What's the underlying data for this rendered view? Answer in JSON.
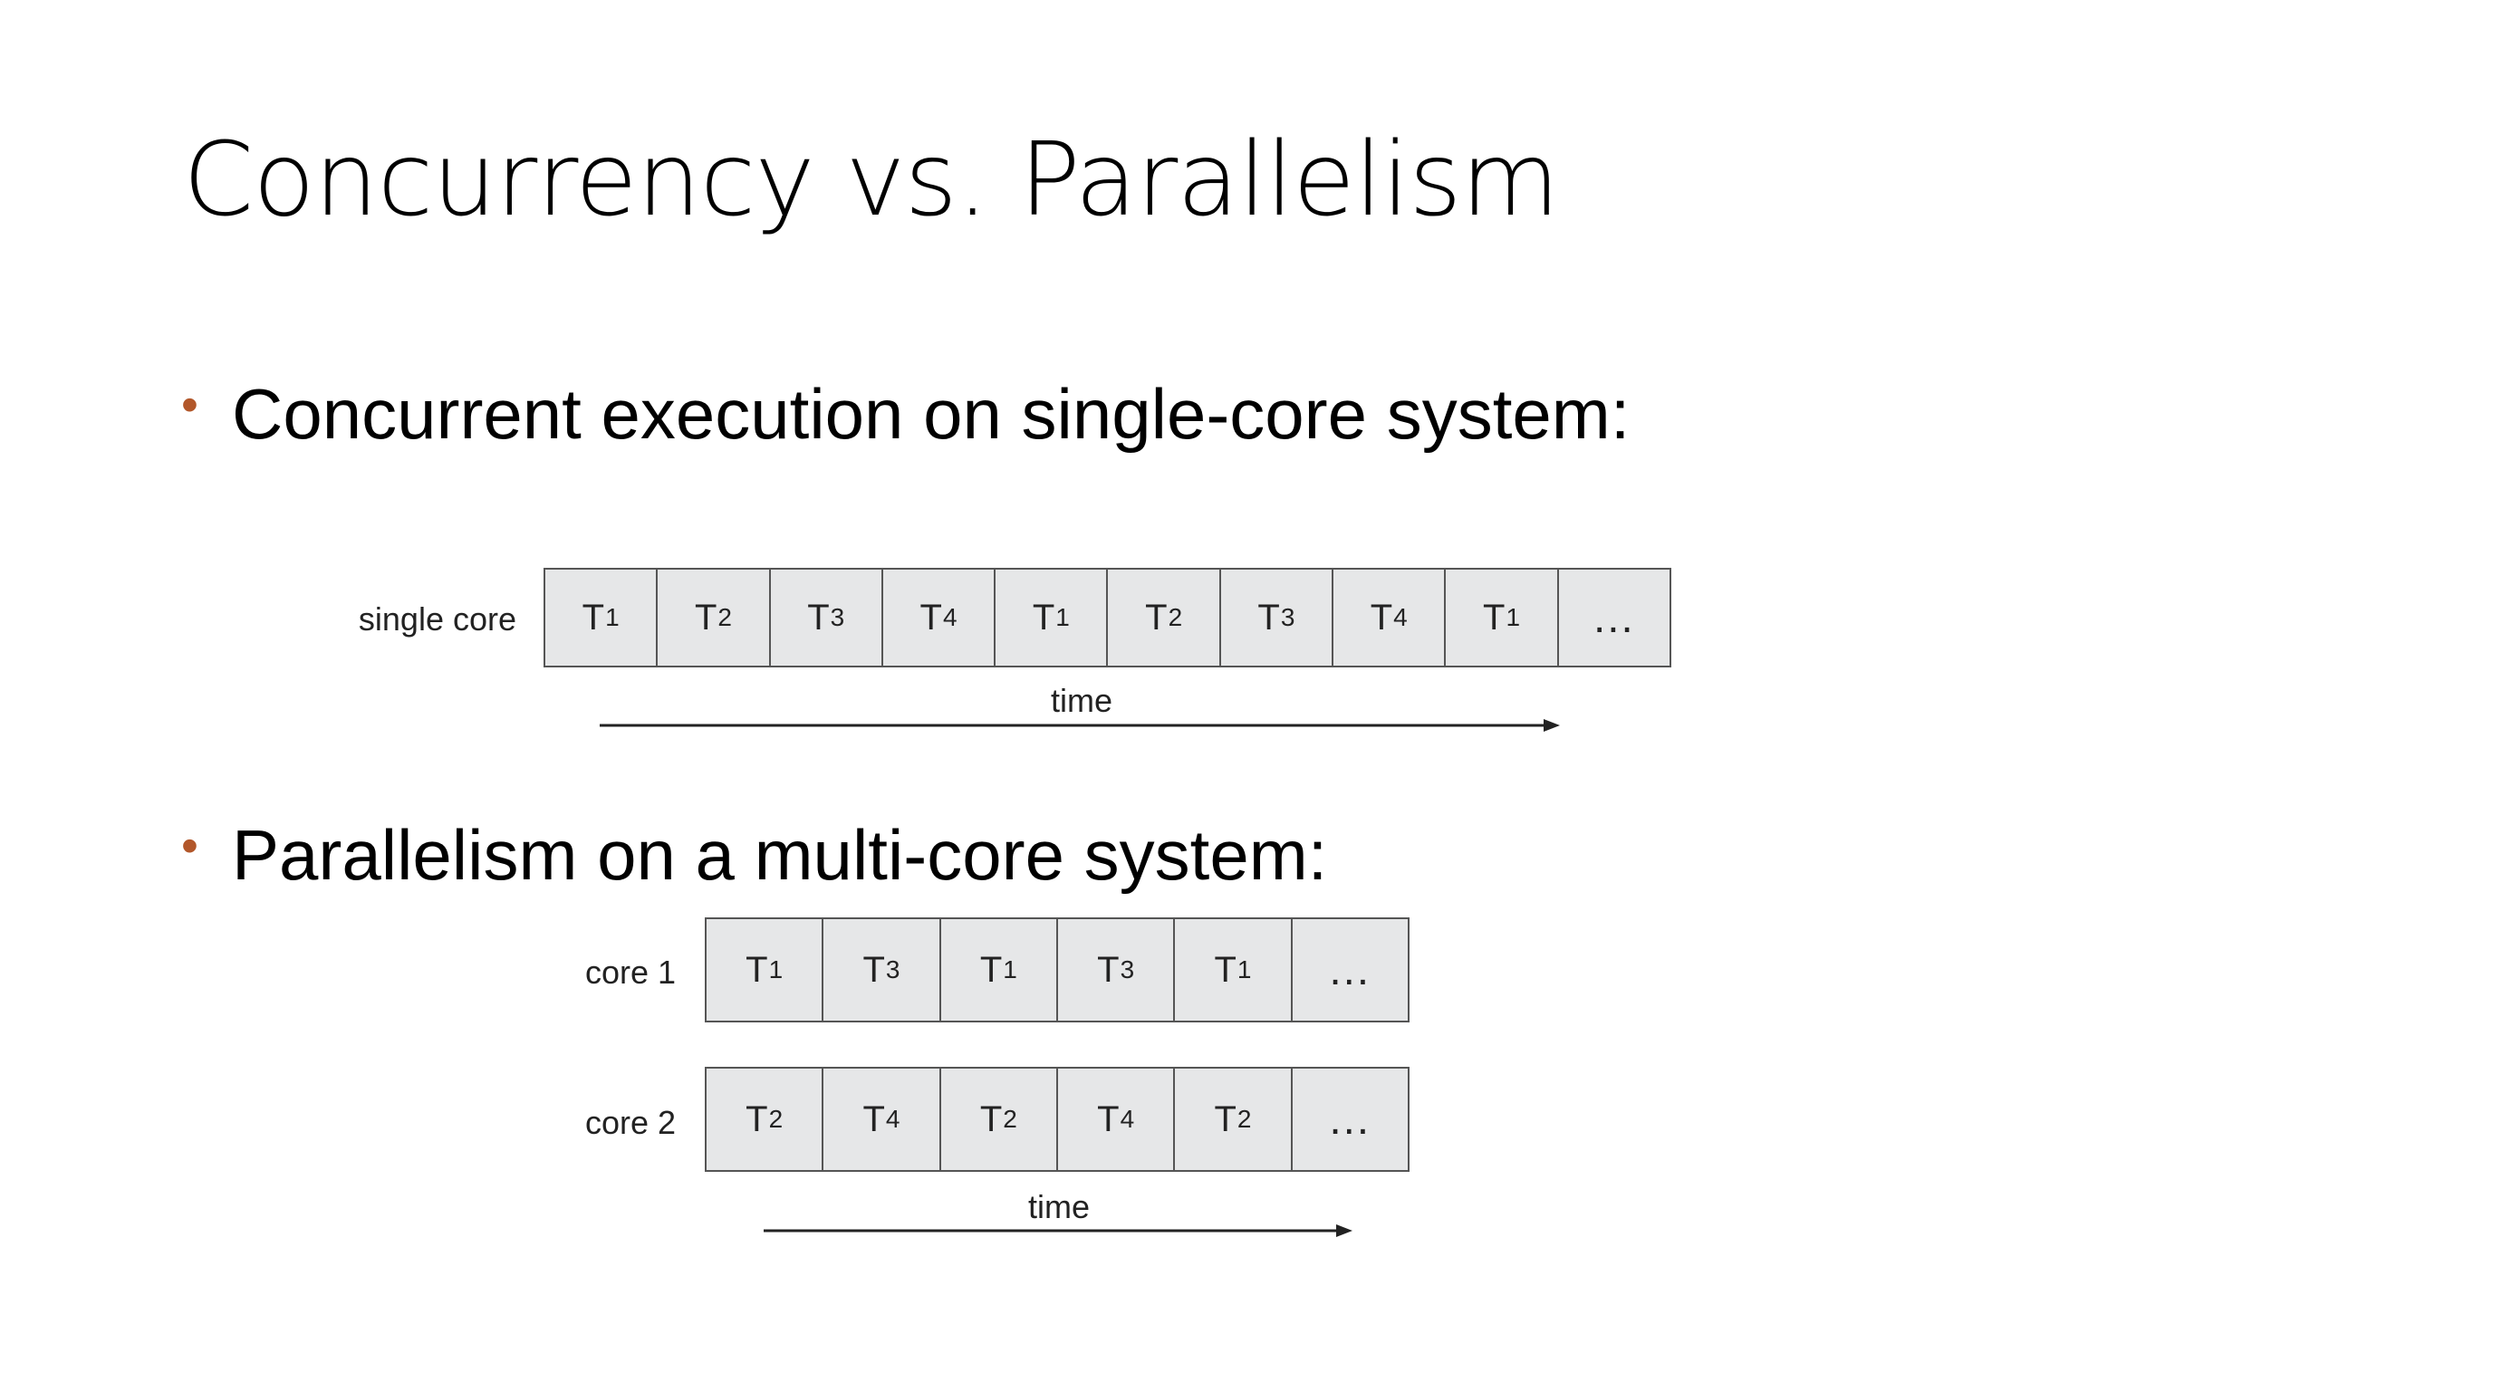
{
  "slide": {
    "title": "Concurrency vs. Parallelism",
    "accent_color": "#b2572a"
  },
  "bullets": [
    {
      "marker": "•",
      "text": "Concurrent execution on single-core system:"
    },
    {
      "marker": "•",
      "text": "Parallelism on a multi-core system:"
    }
  ],
  "single_core": {
    "label": "single core",
    "time_label": "time",
    "cells": [
      {
        "base": "T",
        "sub": "1"
      },
      {
        "base": "T",
        "sub": "2"
      },
      {
        "base": "T",
        "sub": "3"
      },
      {
        "base": "T",
        "sub": "4"
      },
      {
        "base": "T",
        "sub": "1"
      },
      {
        "base": "T",
        "sub": "2"
      },
      {
        "base": "T",
        "sub": "3"
      },
      {
        "base": "T",
        "sub": "4"
      },
      {
        "base": "T",
        "sub": "1"
      },
      {
        "base": "…",
        "sub": ""
      }
    ]
  },
  "multi_core": {
    "time_label": "time",
    "cores": [
      {
        "label": "core 1",
        "cells": [
          {
            "base": "T",
            "sub": "1"
          },
          {
            "base": "T",
            "sub": "3"
          },
          {
            "base": "T",
            "sub": "1"
          },
          {
            "base": "T",
            "sub": "3"
          },
          {
            "base": "T",
            "sub": "1"
          },
          {
            "base": "…",
            "sub": ""
          }
        ]
      },
      {
        "label": "core 2",
        "cells": [
          {
            "base": "T",
            "sub": "2"
          },
          {
            "base": "T",
            "sub": "4"
          },
          {
            "base": "T",
            "sub": "2"
          },
          {
            "base": "T",
            "sub": "4"
          },
          {
            "base": "T",
            "sub": "2"
          },
          {
            "base": "…",
            "sub": ""
          }
        ]
      }
    ]
  }
}
